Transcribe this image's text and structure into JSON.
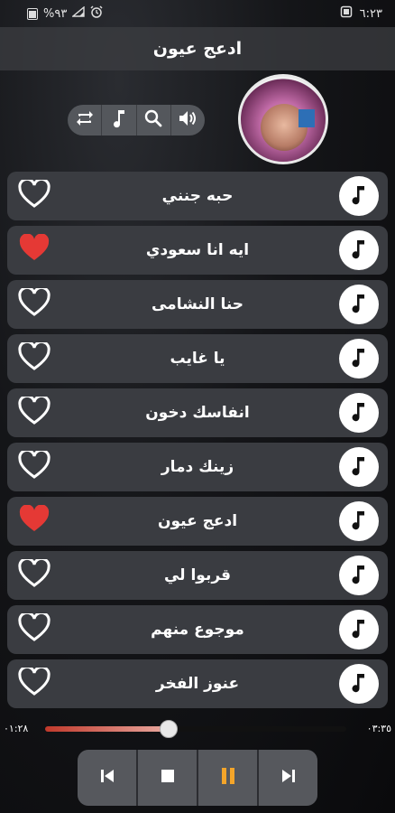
{
  "status": {
    "time": "٦:٢٣",
    "battery": "%٩٣",
    "icons": [
      "battery-icon",
      "signal-icon",
      "alarm-icon",
      "screenshot-icon"
    ]
  },
  "app": {
    "title": "ادعج عيون"
  },
  "header_controls": [
    "repeat-icon",
    "music-note-icon",
    "search-icon",
    "volume-icon"
  ],
  "songs": [
    {
      "title": "حبه جنني",
      "favorite": false
    },
    {
      "title": "ايه انا سعودي",
      "favorite": true
    },
    {
      "title": "حنا النشامى",
      "favorite": false
    },
    {
      "title": "يا غايب",
      "favorite": false
    },
    {
      "title": "انفاسك دخون",
      "favorite": false
    },
    {
      "title": "زينك دمار",
      "favorite": false
    },
    {
      "title": "ادعج عيون",
      "favorite": true
    },
    {
      "title": "قربوا لي",
      "favorite": false
    },
    {
      "title": "موجوع منهم",
      "favorite": false
    },
    {
      "title": "عنوز الفخر",
      "favorite": false
    }
  ],
  "player": {
    "elapsed": "٠١:٢٨",
    "duration": "٠٣:٣٥",
    "progress": 0.41,
    "buttons": [
      "previous-icon",
      "stop-icon",
      "pause-icon",
      "next-icon"
    ]
  },
  "colors": {
    "heart_active": "#e53935",
    "pause_accent": "#f4a52a",
    "row_bg": "#3a3c41"
  }
}
